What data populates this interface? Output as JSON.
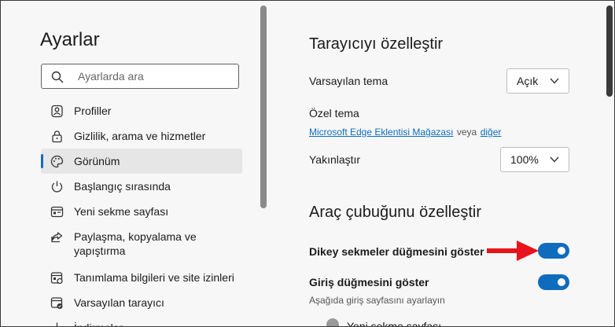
{
  "left": {
    "title": "Ayarlar",
    "search": {
      "placeholder": "Ayarlarda ara"
    },
    "items": [
      {
        "label": "Profiller"
      },
      {
        "label": "Gizlilik, arama ve hizmetler"
      },
      {
        "label": "Görünüm",
        "active": true
      },
      {
        "label": "Başlangıç sırasında"
      },
      {
        "label": "Yeni sekme sayfası"
      },
      {
        "label": "Paylaşma, kopyalama ve yapıştırma"
      },
      {
        "label": "Tanımlama bilgileri ve site izinleri"
      },
      {
        "label": "Varsayılan tarayıcı"
      },
      {
        "label": "İndirmeler"
      }
    ]
  },
  "right": {
    "section1_title": "Tarayıcıyı özelleştir",
    "default_theme_label": "Varsayılan tema",
    "default_theme_value": "Açık",
    "custom_theme_label": "Özel tema",
    "store_link": "Microsoft Edge Eklentisi Mağazası",
    "or_text": "veya",
    "other_link": "diğer",
    "zoom_label": "Yakınlaştır",
    "zoom_value": "100%",
    "section2_title": "Araç çubuğunu özelleştir",
    "vertical_tabs_label": "Dikey sekmeler düğmesini göster",
    "vertical_tabs_on": true,
    "home_button_label": "Giriş düğmesini göster",
    "home_button_on": true,
    "home_button_sub": "Aşağıda giriş sayfasını ayarlayın",
    "partial_option": "Yeni sekme sayfası"
  },
  "colors": {
    "accent": "#0f6cbd",
    "arrow": "#e8131b"
  }
}
